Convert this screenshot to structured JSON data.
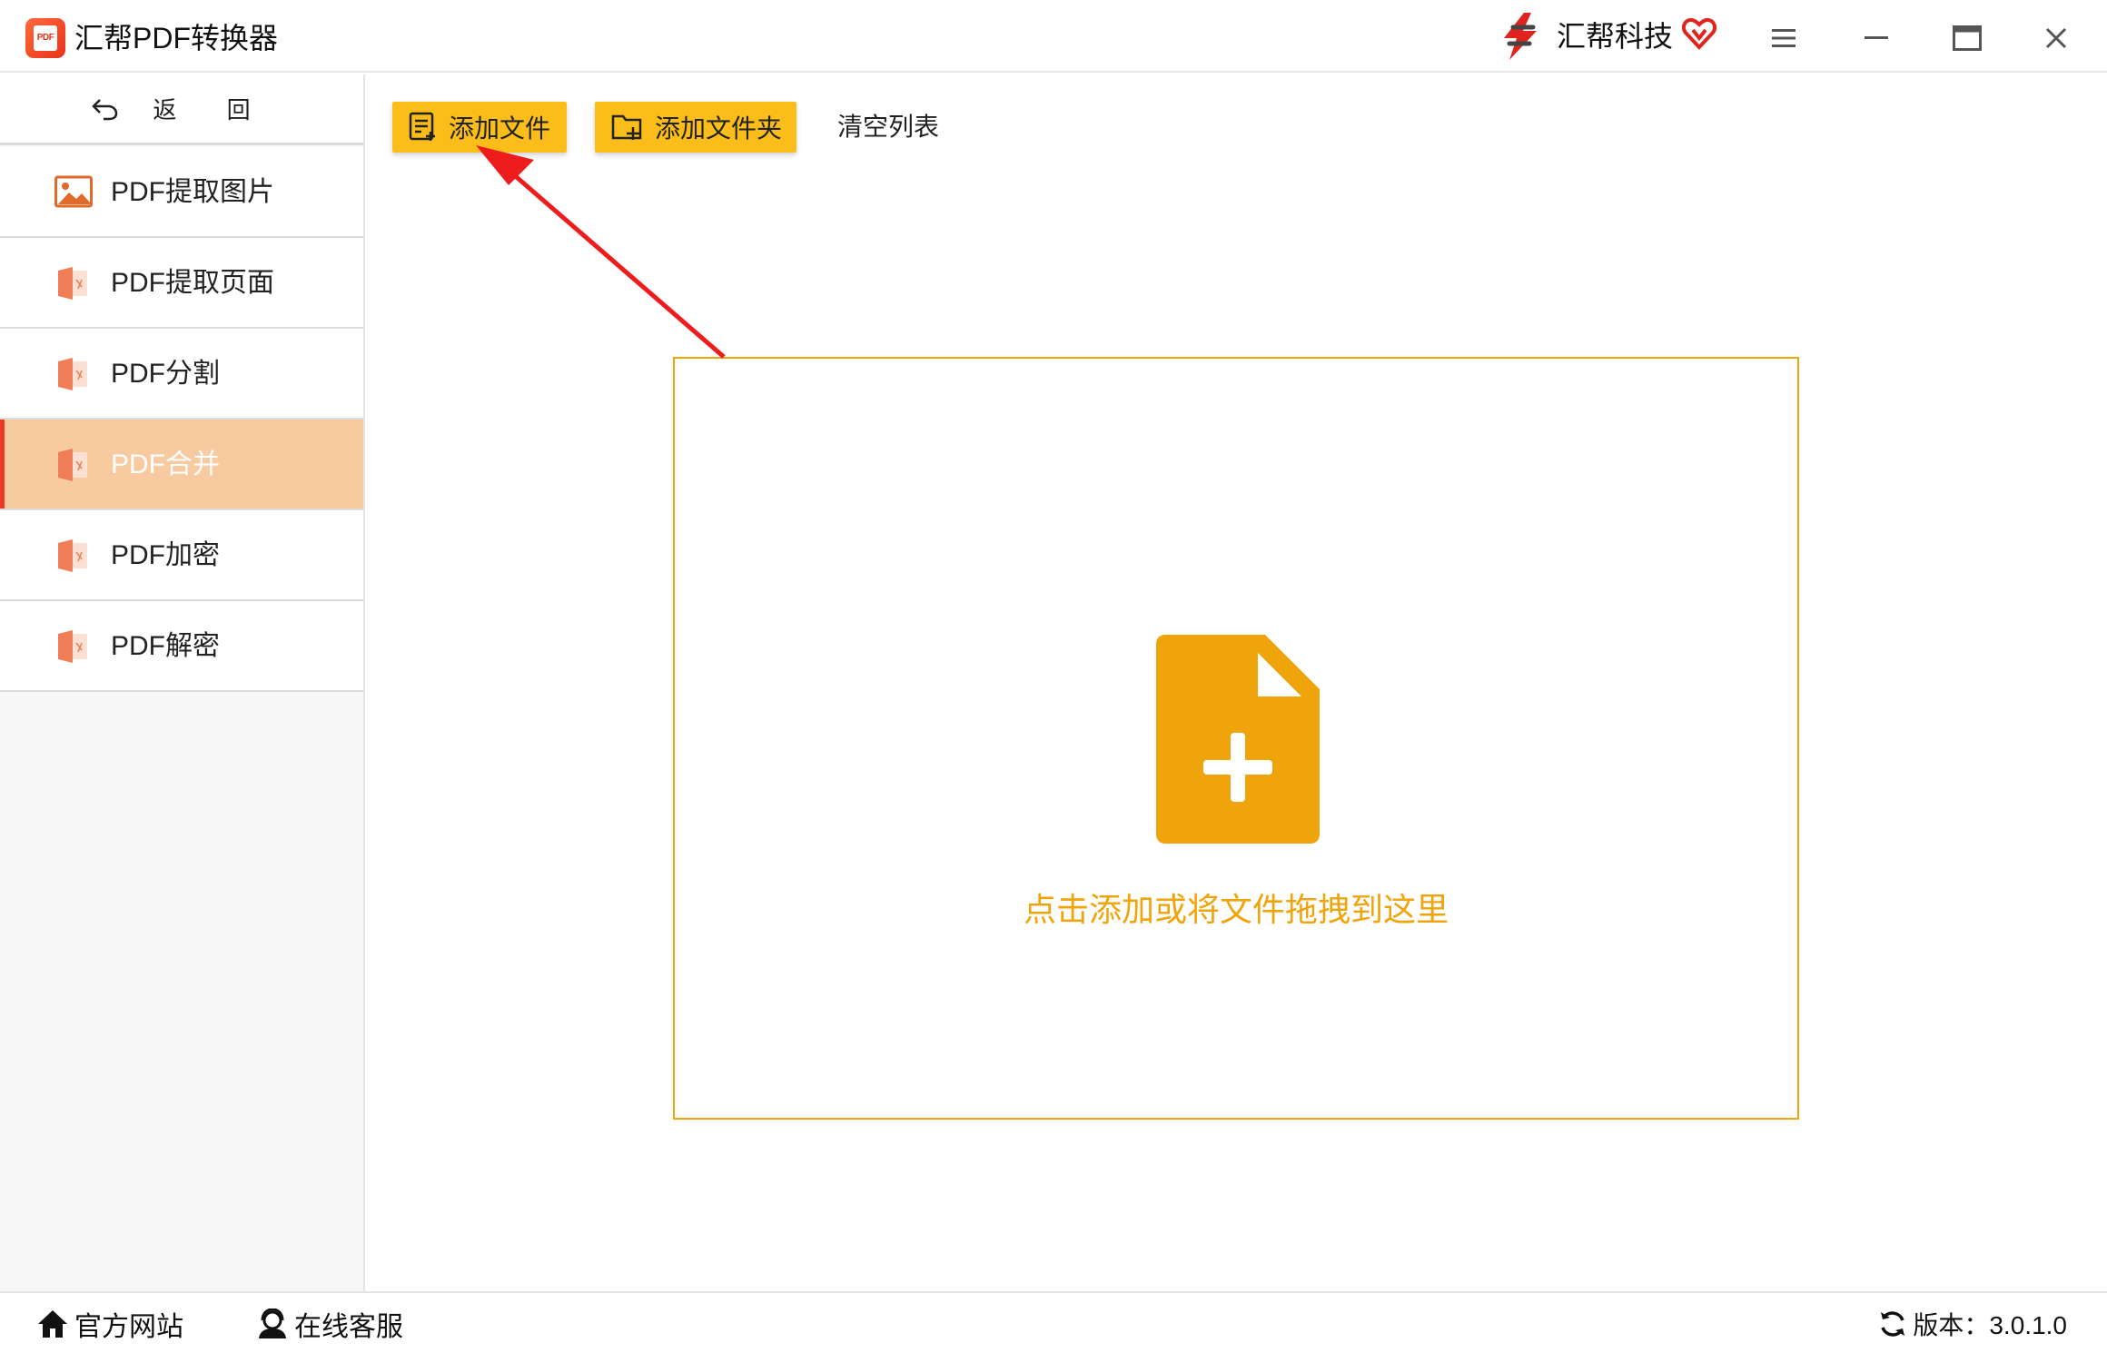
{
  "titlebar": {
    "app_title": "汇帮PDF转换器",
    "app_logo_text": "PDF",
    "brand_name": "汇帮科技",
    "icons": [
      "app-logo-icon",
      "brand-logo-icon",
      "vip-heart-icon",
      "menu-icon",
      "minimize-icon",
      "maximize-icon",
      "close-icon"
    ]
  },
  "sidebar": {
    "back_label": "返  回",
    "items": [
      {
        "label": "PDF提取图片",
        "icon": "image-icon",
        "active": false
      },
      {
        "label": "PDF提取页面",
        "icon": "pdf-file-icon",
        "active": false
      },
      {
        "label": "PDF分割",
        "icon": "pdf-file-icon",
        "active": false
      },
      {
        "label": "PDF合并",
        "icon": "pdf-file-icon",
        "active": true
      },
      {
        "label": "PDF加密",
        "icon": "pdf-file-icon",
        "active": false
      },
      {
        "label": "PDF解密",
        "icon": "pdf-file-icon",
        "active": false
      }
    ]
  },
  "toolbar": {
    "add_file_label": "添加文件",
    "add_folder_label": "添加文件夹",
    "clear_list_label": "清空列表"
  },
  "dropzone": {
    "hint": "点击添加或将文件拖拽到这里",
    "icon": "add-file-icon"
  },
  "footer": {
    "website_label": "官方网站",
    "support_label": "在线客服",
    "version_label": "版本：3.0.1.0"
  },
  "colors": {
    "accent_yellow": "#fbbd19",
    "drop_orange": "#f0a40b",
    "active_item_bg": "#f8caa0",
    "active_marker": "#ea3a26",
    "annotation_arrow": "#ee1d1d"
  }
}
